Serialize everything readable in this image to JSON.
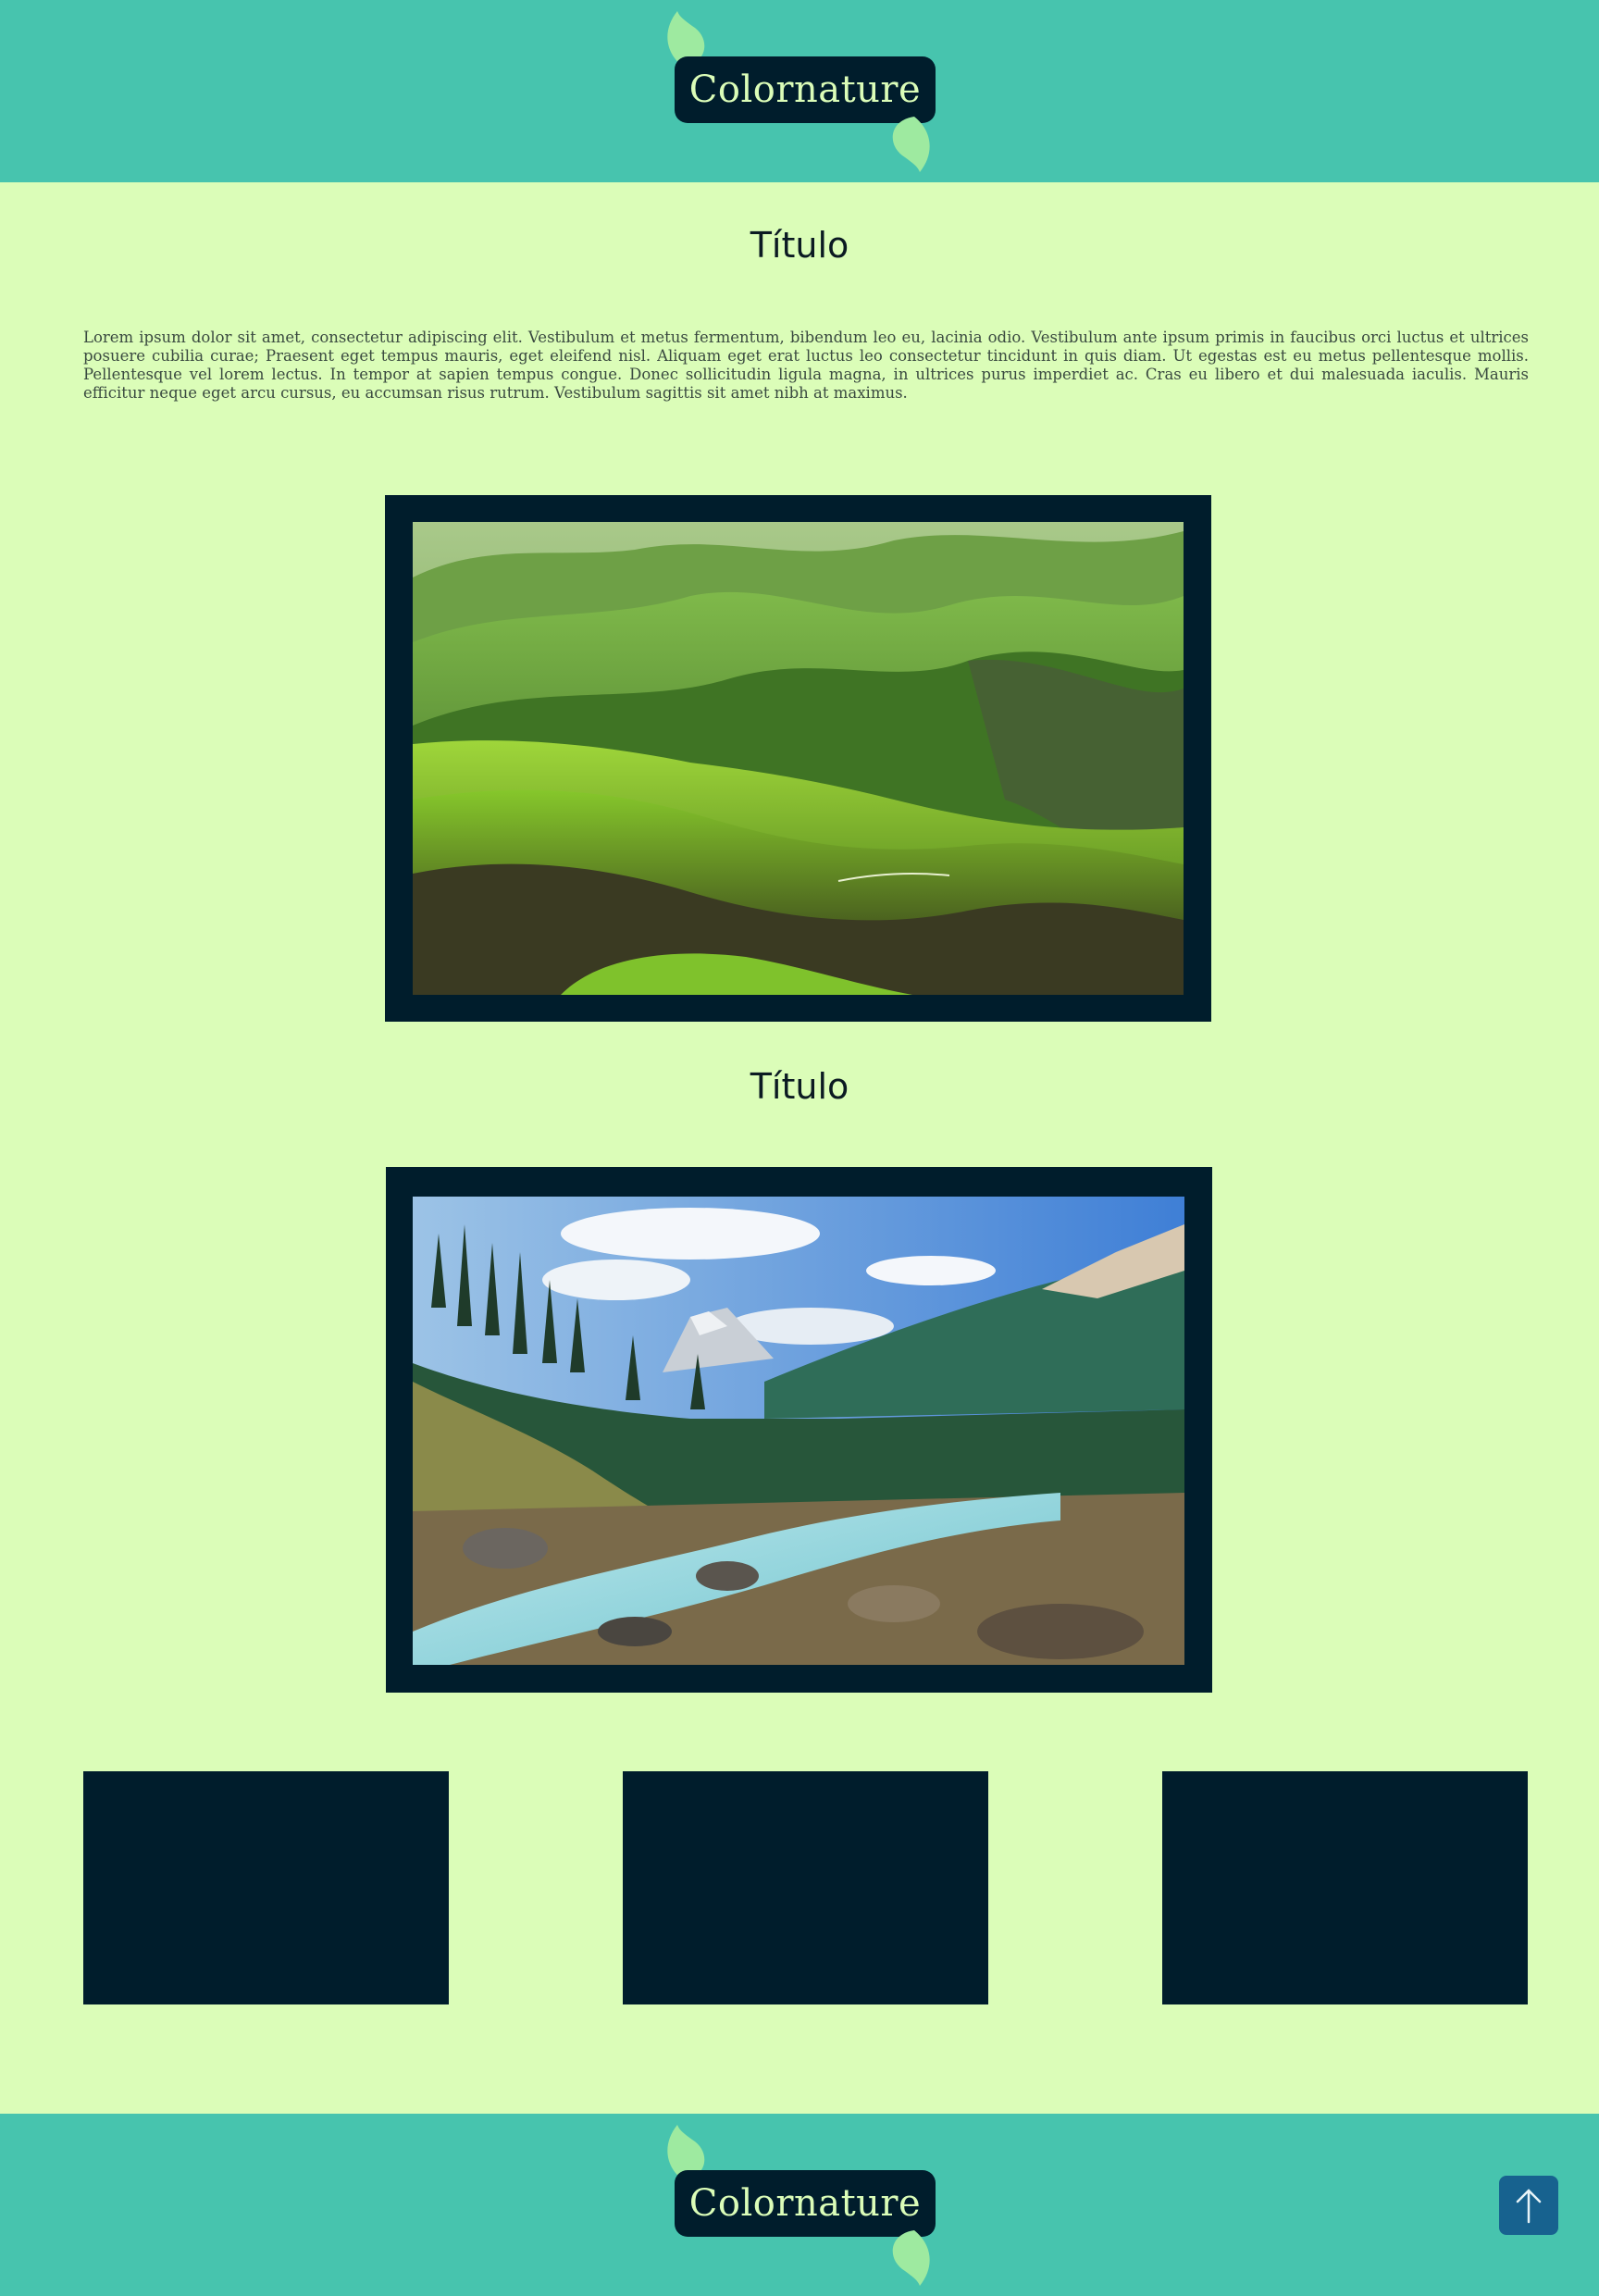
{
  "header": {
    "logo_text": "Colornature"
  },
  "main": {
    "section1_title": "Título",
    "intro_text": "Lorem ipsum dolor sit amet, consectetur adipiscing elit. Vestibulum et metus fermentum, bibendum leo eu, lacinia odio. Vestibulum ante ipsum primis in faucibus orci luctus et ultrices posuere cubilia curae; Praesent eget tempus mauris, eget eleifend nisl. Aliquam eget erat luctus leo consectetur tincidunt in quis diam. Ut egestas est eu metus pellentesque mollis. Pellentesque vel lorem lectus. In tempor at sapien tempus congue. Donec sollicitudin ligula magna, in ultrices purus imperdiet ac. Cras eu libero et dui malesuada iaculis. Mauris efficitur neque eget arcu cursus, eu accumsan risus rutrum. Vestibulum sagittis sit amet nibh at maximus.",
    "photo1": {
      "subject": "green rolling hills"
    },
    "section2_title": "Título",
    "photo2": {
      "subject": "mountain river valley with forest"
    },
    "cards_count": 3
  },
  "footer": {
    "logo_text": "Colornature",
    "back_to_top_icon": "arrow-up-icon"
  },
  "colors": {
    "background": "#dbfdb8",
    "band": "#47c4ae",
    "dark": "#001d2c",
    "button": "#17628f",
    "leaf": "#9eeaa0"
  }
}
